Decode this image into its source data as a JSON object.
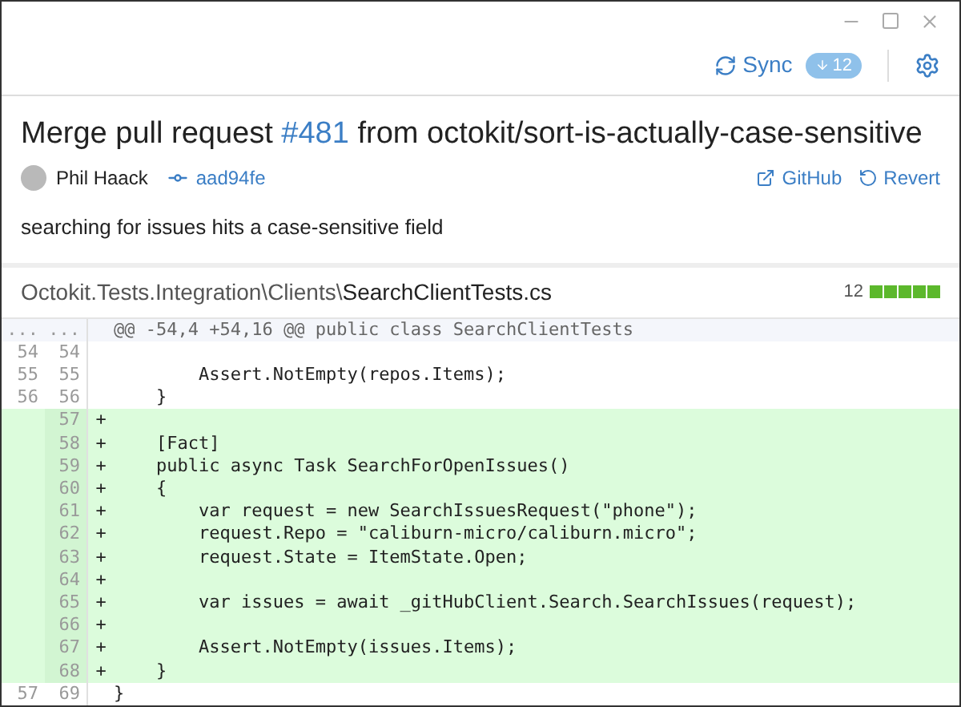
{
  "toolbar": {
    "sync_label": "Sync",
    "sync_count": "12"
  },
  "commit": {
    "title_before": "Merge pull request",
    "pr_number": "#481",
    "title_after": "from octokit/sort-is-actually-case-sensitive",
    "author": "Phil Haack",
    "sha": "aad94fe",
    "actions": [
      "GitHub",
      "Revert"
    ],
    "message": "searching for issues hits a case-sensitive field"
  },
  "file": {
    "directory": "Octokit.Tests.Integration\\Clients\\",
    "filename": "SearchClientTests.cs",
    "changes": "12",
    "diffstat": [
      {
        "kind": "added"
      },
      {
        "kind": "added"
      },
      {
        "kind": "added"
      },
      {
        "kind": "added"
      },
      {
        "kind": "added"
      }
    ]
  },
  "diff": [
    {
      "kind": "hunk",
      "old": "...",
      "new": "...",
      "code": "@@ -54,4 +54,16 @@ public class SearchClientTests"
    },
    {
      "kind": "context",
      "old": "54",
      "new": "54"
    },
    {
      "kind": "context",
      "old": "55",
      "new": "55",
      "code": "        Assert.NotEmpty(repos.Items);"
    },
    {
      "kind": "context",
      "old": "56",
      "new": "56",
      "code": "    }"
    },
    {
      "kind": "added",
      "new": "57",
      "sign": "+"
    },
    {
      "kind": "added",
      "new": "58",
      "sign": "+",
      "code": "    [Fact]"
    },
    {
      "kind": "added",
      "new": "59",
      "sign": "+",
      "code": "    public async Task SearchForOpenIssues()"
    },
    {
      "kind": "added",
      "new": "60",
      "sign": "+",
      "code": "    {"
    },
    {
      "kind": "added",
      "new": "61",
      "sign": "+",
      "code": "        var request = new SearchIssuesRequest(\"phone\");"
    },
    {
      "kind": "added",
      "new": "62",
      "sign": "+",
      "code": "        request.Repo = \"caliburn-micro/caliburn.micro\";"
    },
    {
      "kind": "added",
      "new": "63",
      "sign": "+",
      "code": "        request.State = ItemState.Open;"
    },
    {
      "kind": "added",
      "new": "64",
      "sign": "+"
    },
    {
      "kind": "added",
      "new": "65",
      "sign": "+",
      "code": "        var issues = await _gitHubClient.Search.SearchIssues(request);"
    },
    {
      "kind": "added",
      "new": "66",
      "sign": "+"
    },
    {
      "kind": "added",
      "new": "67",
      "sign": "+",
      "code": "        Assert.NotEmpty(issues.Items);"
    },
    {
      "kind": "added",
      "new": "68",
      "sign": "+",
      "code": "    }"
    },
    {
      "kind": "context",
      "old": "57",
      "new": "69",
      "code": "}"
    }
  ]
}
